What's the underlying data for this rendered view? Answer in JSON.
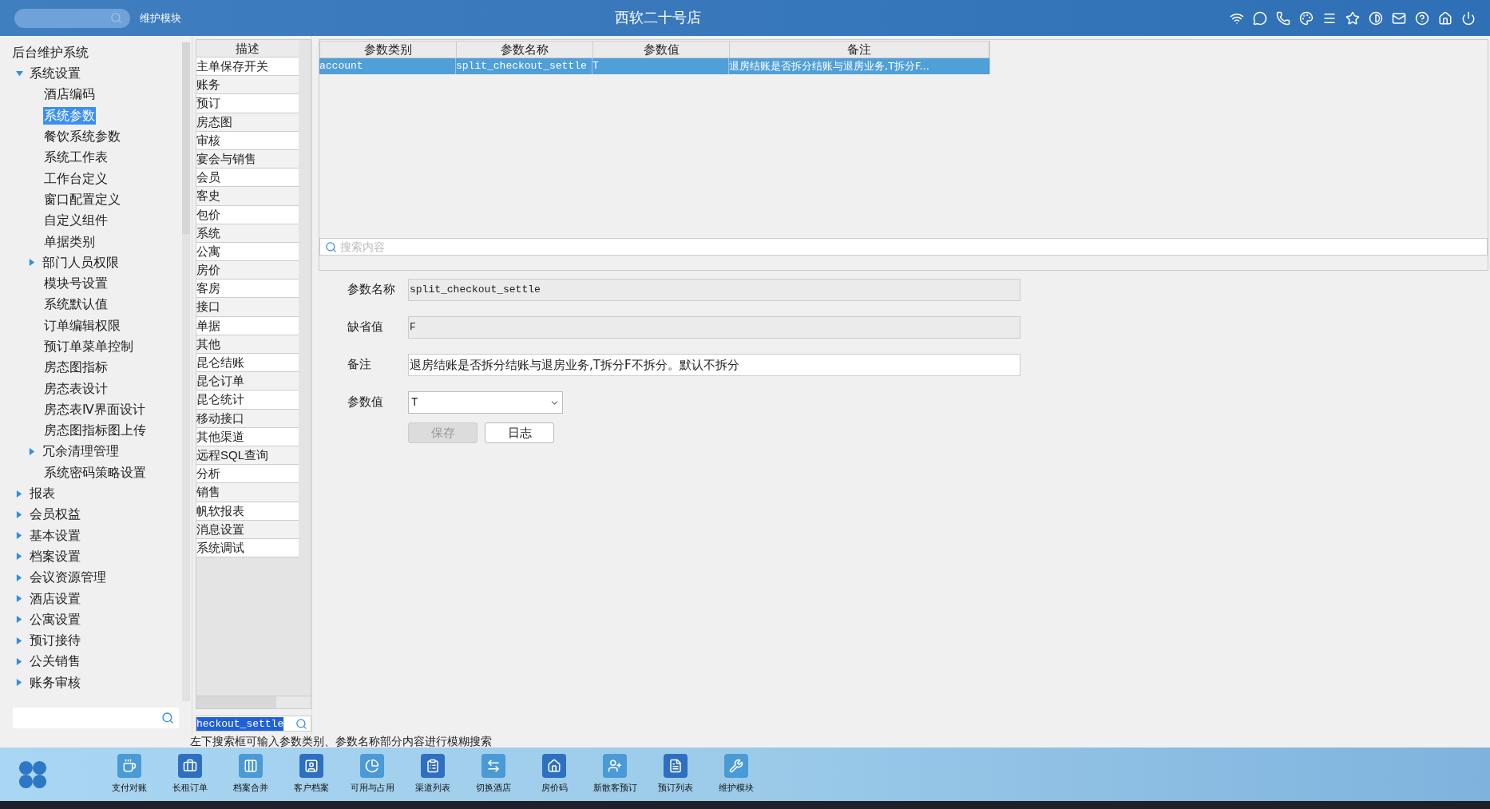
{
  "top_bar": {
    "module_label": "维护模块",
    "title": "西软二十号店"
  },
  "tree": {
    "root": "后台维护系统",
    "items": [
      {
        "label": "系统设置",
        "kind": "folder",
        "expanded": true,
        "selected": false,
        "children": [
          {
            "label": "酒店编码",
            "kind": "leaf",
            "selected": false
          },
          {
            "label": "系统参数",
            "kind": "leaf",
            "selected": true
          },
          {
            "label": "餐饮系统参数",
            "kind": "leaf",
            "selected": false
          },
          {
            "label": "系统工作表",
            "kind": "leaf",
            "selected": false
          },
          {
            "label": "工作台定义",
            "kind": "leaf",
            "selected": false
          },
          {
            "label": "窗口配置定义",
            "kind": "leaf",
            "selected": false
          },
          {
            "label": "自定义组件",
            "kind": "leaf",
            "selected": false
          },
          {
            "label": "单据类别",
            "kind": "leaf",
            "selected": false
          },
          {
            "label": "部门人员权限",
            "kind": "folder",
            "expanded": false,
            "selected": false
          },
          {
            "label": "模块号设置",
            "kind": "leaf",
            "selected": false
          },
          {
            "label": "系统默认值",
            "kind": "leaf",
            "selected": false
          },
          {
            "label": "订单编辑权限",
            "kind": "leaf",
            "selected": false
          },
          {
            "label": "预订单菜单控制",
            "kind": "leaf",
            "selected": false
          },
          {
            "label": "房态图指标",
            "kind": "leaf",
            "selected": false
          },
          {
            "label": "房态表设计",
            "kind": "leaf",
            "selected": false
          },
          {
            "label": "房态表Ⅳ界面设计",
            "kind": "leaf",
            "selected": false
          },
          {
            "label": "房态图指标图上传",
            "kind": "leaf",
            "selected": false
          },
          {
            "label": "冗余清理管理",
            "kind": "folder",
            "expanded": false,
            "selected": false
          },
          {
            "label": "系统密码策略设置",
            "kind": "leaf",
            "selected": false
          }
        ]
      },
      {
        "label": "报表",
        "kind": "folder",
        "expanded": false,
        "selected": false
      },
      {
        "label": "会员权益",
        "kind": "folder",
        "expanded": false,
        "selected": false
      },
      {
        "label": "基本设置",
        "kind": "folder",
        "expanded": false,
        "selected": false
      },
      {
        "label": "档案设置",
        "kind": "folder",
        "expanded": false,
        "selected": false
      },
      {
        "label": "会议资源管理",
        "kind": "folder",
        "expanded": false,
        "selected": false
      },
      {
        "label": "酒店设置",
        "kind": "folder",
        "expanded": false,
        "selected": false
      },
      {
        "label": "公寓设置",
        "kind": "folder",
        "expanded": false,
        "selected": false
      },
      {
        "label": "预订接待",
        "kind": "folder",
        "expanded": false,
        "selected": false
      },
      {
        "label": "公关销售",
        "kind": "folder",
        "expanded": false,
        "selected": false
      },
      {
        "label": "账务审核",
        "kind": "folder",
        "expanded": false,
        "selected": false
      }
    ]
  },
  "desc_list": {
    "header": "描述",
    "search_value": "heckout_settle",
    "items": [
      "主单保存开关",
      "账务",
      "预订",
      "房态图",
      "审核",
      "宴会与销售",
      "会员",
      "客史",
      "包价",
      "系统",
      "公寓",
      "房价",
      "客房",
      "接口",
      "单据",
      "其他",
      "昆仑结账",
      "昆仑订单",
      "昆仑统计",
      "移动接口",
      "其他渠道",
      "远程SQL查询",
      "分析",
      "销售",
      "帆软报表",
      "消息设置",
      "系统调试"
    ]
  },
  "params_table": {
    "columns": [
      "参数类别",
      "参数名称",
      "参数值",
      "备注"
    ],
    "rows": [
      {
        "cells": [
          "account",
          "split_checkout_settle",
          "T",
          "退房结账是否拆分结账与退房业务,T拆分F..."
        ],
        "selected": true
      }
    ],
    "search": {
      "placeholder": "搜索内容"
    }
  },
  "form": {
    "fields": [
      {
        "label": "参数名称",
        "value": "split_checkout_settle",
        "kind": "readonly"
      },
      {
        "label": "缺省值",
        "value": "F",
        "kind": "readonly"
      },
      {
        "label": "备注",
        "value": "退房结账是否拆分结账与退房业务,T拆分F不拆分。默认不拆分",
        "kind": "text"
      },
      {
        "label": "参数值",
        "value": "T",
        "kind": "select"
      }
    ],
    "buttons": [
      {
        "label": "保存",
        "disabled": true
      },
      {
        "label": "日志",
        "disabled": false
      }
    ]
  },
  "status_text": "左下搜索框可输入参数类别、参数名称部分内容进行模糊搜索",
  "dock": {
    "items": [
      {
        "label": "支付对账"
      },
      {
        "label": "长租订单"
      },
      {
        "label": "档案合并"
      },
      {
        "label": "客户档案"
      },
      {
        "label": "可用与占用"
      },
      {
        "label": "渠道列表"
      },
      {
        "label": "切换酒店"
      },
      {
        "label": "房价码"
      },
      {
        "label": "新散客预订"
      },
      {
        "label": "预订列表"
      },
      {
        "label": "维护模块"
      }
    ]
  }
}
